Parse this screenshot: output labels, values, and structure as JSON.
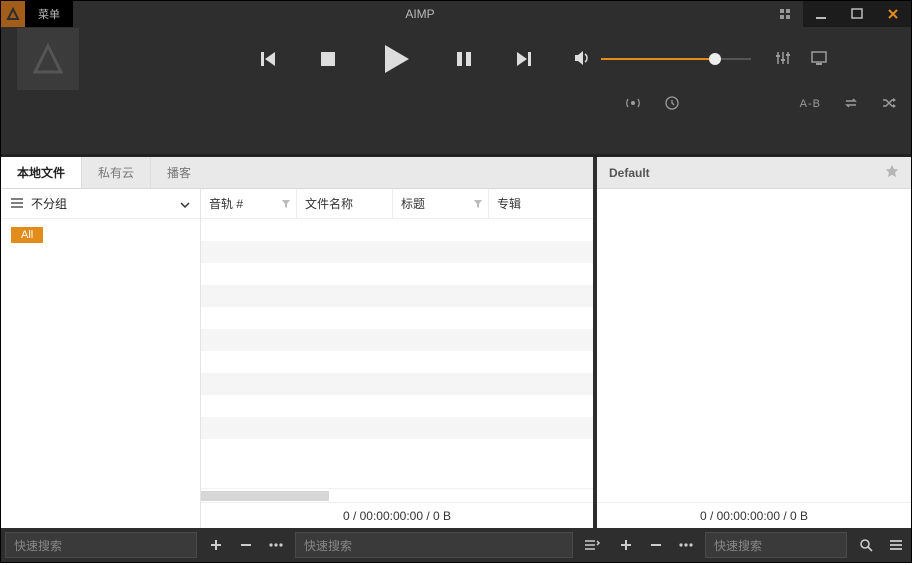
{
  "titlebar": {
    "menu": "菜单",
    "app": "AIMP"
  },
  "player": {
    "volume_percent": 76
  },
  "tabs": [
    {
      "label": "本地文件",
      "active": true
    },
    {
      "label": "私有云",
      "active": false
    },
    {
      "label": "播客",
      "active": false
    }
  ],
  "sidebar": {
    "group_label": "不分组",
    "badge_all": "All"
  },
  "grid_headers": [
    "音轨 #",
    "文件名称",
    "标题",
    "专辑"
  ],
  "left_status": "0 / 00:00:00:00 / 0 B",
  "right": {
    "title": "Default",
    "status": "0 / 00:00:00:00 / 0 B"
  },
  "footer": {
    "search_placeholder": "快速搜索",
    "ab_label": "A-B"
  }
}
